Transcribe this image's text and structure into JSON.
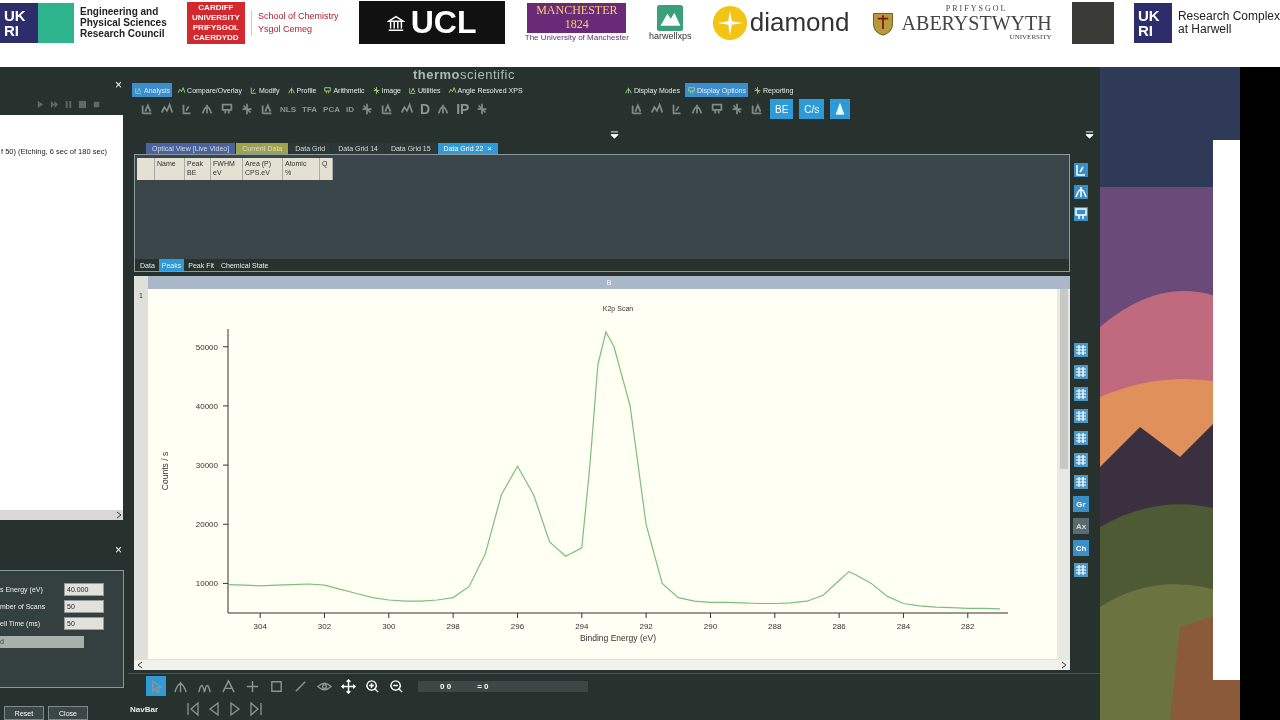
{
  "banner": {
    "logos": [
      {
        "kind": "ukri",
        "mark": [
          "UK",
          "RI"
        ],
        "lines": [
          "Engineering and",
          "Physical Sciences",
          "Research Council"
        ]
      },
      {
        "kind": "cardiff",
        "mark": [
          "CARDIFF",
          "UNIVERSITY",
          "PRIFYSGOL",
          "CAERDYDD"
        ],
        "lines": [
          "School of Chemistry",
          "Ysgol Cemeg"
        ]
      },
      {
        "kind": "ucl",
        "mark": [
          "UCL"
        ]
      },
      {
        "kind": "manchester",
        "mark": [
          "MANCHESTER",
          "1824"
        ],
        "lines": [
          "The University of Manchester"
        ]
      },
      {
        "kind": "harwell",
        "lines": [
          "harwellxps"
        ]
      },
      {
        "kind": "diamond",
        "lines": [
          "diamond"
        ]
      },
      {
        "kind": "aber",
        "lines": [
          "PRIFYSGOL",
          "ABERYSTWYTH",
          "UNIVERSITY"
        ]
      },
      {
        "kind": "royce"
      },
      {
        "kind": "ukri",
        "mark": [
          "UK",
          "RI"
        ],
        "lines": [
          "Research Complex",
          "at Harwell"
        ]
      }
    ]
  },
  "left_panel": {
    "close": "×",
    "status": "f 50) (Etching, 6 sec of 180 sec)",
    "settings": {
      "close": "×",
      "fields": [
        {
          "label": "s Energy (eV)",
          "value": "40.000"
        },
        {
          "label": "mber of Scans",
          "value": "50"
        },
        {
          "label": "ell Time  (ms)",
          "value": "50"
        }
      ],
      "dropdown": {
        "value": "d",
        "disabled": true
      },
      "buttons": [
        "Reset",
        "Close"
      ]
    }
  },
  "brand": "**thermo**scientific",
  "ribbon": {
    "groups": [
      {
        "tabs": [
          {
            "label": "Analysis",
            "selected": true
          },
          {
            "label": "Compare/Overlay",
            "selected": false
          },
          {
            "label": "Modify",
            "selected": false
          },
          {
            "label": "Profile",
            "selected": false
          },
          {
            "label": "Arithmetic",
            "selected": false
          },
          {
            "label": "Image",
            "selected": false
          },
          {
            "label": "Utilities",
            "selected": false
          },
          {
            "label": "Angle Resolved XPS",
            "selected": false
          }
        ],
        "tools": [
          {
            "kind": "icon"
          },
          {
            "kind": "icon"
          },
          {
            "kind": "icon"
          },
          {
            "kind": "icon"
          },
          {
            "kind": "icon"
          },
          {
            "kind": "icon"
          },
          {
            "kind": "icon"
          },
          {
            "kind": "text",
            "label": "NLS"
          },
          {
            "kind": "text",
            "label": "TFA"
          },
          {
            "kind": "text",
            "label": "PCA"
          },
          {
            "kind": "text",
            "label": "ID"
          },
          {
            "kind": "icon"
          },
          {
            "kind": "icon"
          },
          {
            "kind": "icon"
          },
          {
            "kind": "big",
            "label": "D"
          },
          {
            "kind": "icon"
          },
          {
            "kind": "big",
            "label": "IP"
          },
          {
            "kind": "icon"
          }
        ]
      },
      {
        "tabs": [
          {
            "label": "Display Modes",
            "selected": false
          },
          {
            "label": "Display Options",
            "selected": true
          },
          {
            "label": "Reporting",
            "selected": false
          }
        ],
        "tools": [
          {
            "kind": "icon"
          },
          {
            "kind": "icon"
          },
          {
            "kind": "icon"
          },
          {
            "kind": "icon"
          },
          {
            "kind": "icon"
          },
          {
            "kind": "icon"
          },
          {
            "kind": "icon"
          },
          {
            "kind": "toggle",
            "label": "BE",
            "on": true
          },
          {
            "kind": "toggle",
            "label": "C/s",
            "on": true
          },
          {
            "kind": "toggle-icon",
            "on": true
          }
        ]
      }
    ]
  },
  "doc_tabs": [
    {
      "label": "Optical View [Live Video]",
      "selected": false,
      "color": "#4a62a0"
    },
    {
      "label": "Current Data",
      "selected": false,
      "color": "#9ea24a"
    },
    {
      "label": "Data Grid",
      "selected": false
    },
    {
      "label": "Data Grid 14",
      "selected": false
    },
    {
      "label": "Data Grid 15",
      "selected": false
    },
    {
      "label": "Data Grid 22",
      "selected": true,
      "close": "×"
    }
  ],
  "grid": {
    "columns": [
      [
        "Name"
      ],
      [
        "Peak",
        "BE"
      ],
      [
        "FWHM",
        "eV"
      ],
      [
        "Area (P)",
        "CPS.eV"
      ],
      [
        "Atomic",
        "%"
      ],
      [
        "Q"
      ]
    ],
    "tabs": [
      {
        "label": "Data",
        "selected": false
      },
      {
        "label": "Peaks",
        "selected": true
      },
      {
        "label": "Peak Fit",
        "selected": false
      },
      {
        "label": "Chemical State",
        "selected": false
      }
    ]
  },
  "plot": {
    "header": "B",
    "row": "1",
    "chart_data": {
      "type": "line",
      "title": "K2p Scan",
      "xlabel": "Binding Energy (eV)",
      "ylabel": "Counts / s",
      "x": [
        305,
        304.5,
        304,
        303.5,
        303,
        302.5,
        302,
        301.5,
        301,
        300.5,
        300,
        299.5,
        299,
        298.5,
        298,
        297.5,
        297,
        296.5,
        296,
        295.5,
        295,
        294.5,
        294,
        293.75,
        293.5,
        293.25,
        293,
        292.5,
        292,
        291.5,
        291,
        290.5,
        290,
        289.5,
        289,
        288.5,
        288,
        287.5,
        287,
        286.5,
        286,
        285.7,
        285.5,
        285,
        284.5,
        284,
        283.5,
        283,
        282.5,
        282,
        281.5,
        281
      ],
      "series": [
        {
          "color": "#7cbf7c",
          "values": [
            9800,
            9700,
            9600,
            9700,
            9800,
            9900,
            9700,
            9000,
            8300,
            7600,
            7200,
            7000,
            7000,
            7200,
            7600,
            9500,
            15000,
            25000,
            29800,
            25000,
            17000,
            14600,
            16000,
            30000,
            47000,
            52500,
            50000,
            40000,
            20000,
            10000,
            7600,
            7000,
            6800,
            6800,
            6700,
            6600,
            6600,
            6700,
            7000,
            8000,
            10500,
            12000,
            11500,
            10000,
            7800,
            6600,
            6200,
            6000,
            5900,
            5800,
            5800,
            5700
          ]
        }
      ],
      "xlim": [
        305,
        280.75
      ],
      "ylim": [
        5000,
        53000
      ],
      "xticks": [
        304,
        302,
        300,
        298,
        296,
        294,
        292,
        290,
        288,
        286,
        284,
        282
      ],
      "yticks": [
        10000,
        20000,
        30000,
        40000,
        50000
      ]
    }
  },
  "side_tools": {
    "top": [
      {
        "kind": "icon"
      },
      {
        "kind": "icon"
      },
      {
        "kind": "icon"
      }
    ],
    "bottom": [
      {
        "kind": "icon",
        "disabled": false
      },
      {
        "kind": "icon",
        "disabled": false
      },
      {
        "kind": "icon",
        "disabled": false
      },
      {
        "kind": "icon",
        "disabled": false
      },
      {
        "kind": "icon",
        "disabled": false
      },
      {
        "kind": "icon",
        "disabled": false
      },
      {
        "kind": "icon",
        "disabled": false
      },
      {
        "kind": "text",
        "label": "Gr",
        "disabled": false
      },
      {
        "kind": "text",
        "label": "Ax",
        "disabled": true
      },
      {
        "kind": "text",
        "label": "Ch",
        "disabled": false
      },
      {
        "kind": "icon",
        "disabled": false
      }
    ]
  },
  "toolbar": {
    "tools": [
      {
        "selected": true
      },
      {
        "selected": false
      },
      {
        "selected": false
      },
      {
        "selected": false
      },
      {
        "selected": false
      },
      {
        "selected": false
      },
      {
        "selected": false
      },
      {
        "selected": false
      },
      {
        "selected": false
      },
      {
        "selected": false
      },
      {
        "selected": false
      }
    ],
    "readout": [
      "0 0",
      "= 0"
    ]
  },
  "navbar": {
    "label": "NavBar"
  }
}
